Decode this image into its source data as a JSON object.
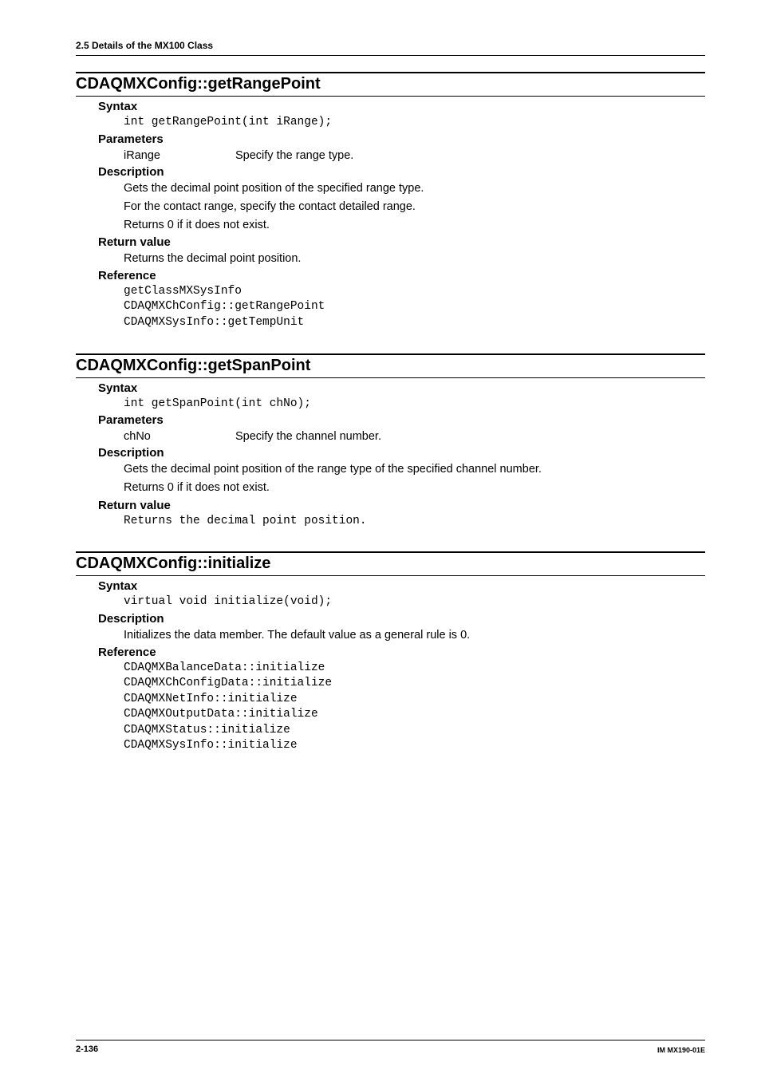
{
  "header": {
    "section": "2.5  Details of the MX100 Class"
  },
  "entries": [
    {
      "title": "CDAQMXConfig::getRangePoint",
      "syntax": {
        "label": "Syntax",
        "code": "int getRangePoint(int iRange);"
      },
      "parameters": {
        "label": "Parameters",
        "rows": [
          {
            "name": "iRange",
            "desc": "Specify the range type."
          }
        ]
      },
      "description": {
        "label": "Description",
        "lines": [
          "Gets the decimal point position of the specified range type.",
          "For the contact range, specify the contact detailed range.",
          "Returns 0 if it does not exist."
        ]
      },
      "returnvalue": {
        "label": "Return value",
        "lines": [
          "Returns the decimal point position."
        ]
      },
      "reference": {
        "label": "Reference",
        "codeblock": "getClassMXSysInfo\nCDAQMXChConfig::getRangePoint\nCDAQMXSysInfo::getTempUnit"
      }
    },
    {
      "title": "CDAQMXConfig::getSpanPoint",
      "syntax": {
        "label": "Syntax",
        "code": "int getSpanPoint(int chNo);"
      },
      "parameters": {
        "label": "Parameters",
        "rows": [
          {
            "name": "chNo",
            "desc": "Specify the channel number."
          }
        ]
      },
      "description": {
        "label": "Description",
        "lines": [
          "Gets the decimal point position of the range type of the specified channel number.",
          "Returns 0 if it does not exist."
        ]
      },
      "returnvalue": {
        "label": "Return value",
        "codeblock": "Returns the decimal point position."
      }
    },
    {
      "title": "CDAQMXConfig::initialize",
      "syntax": {
        "label": "Syntax",
        "code": "virtual void initialize(void);"
      },
      "description": {
        "label": "Description",
        "lines": [
          "Initializes the data member. The default value as a general rule is 0."
        ]
      },
      "reference": {
        "label": "Reference",
        "codeblock": "CDAQMXBalanceData::initialize\nCDAQMXChConfigData::initialize\nCDAQMXNetInfo::initialize\nCDAQMXOutputData::initialize\nCDAQMXStatus::initialize\nCDAQMXSysInfo::initialize"
      }
    }
  ],
  "footer": {
    "left": "2-136",
    "right": "IM MX190-01E"
  }
}
